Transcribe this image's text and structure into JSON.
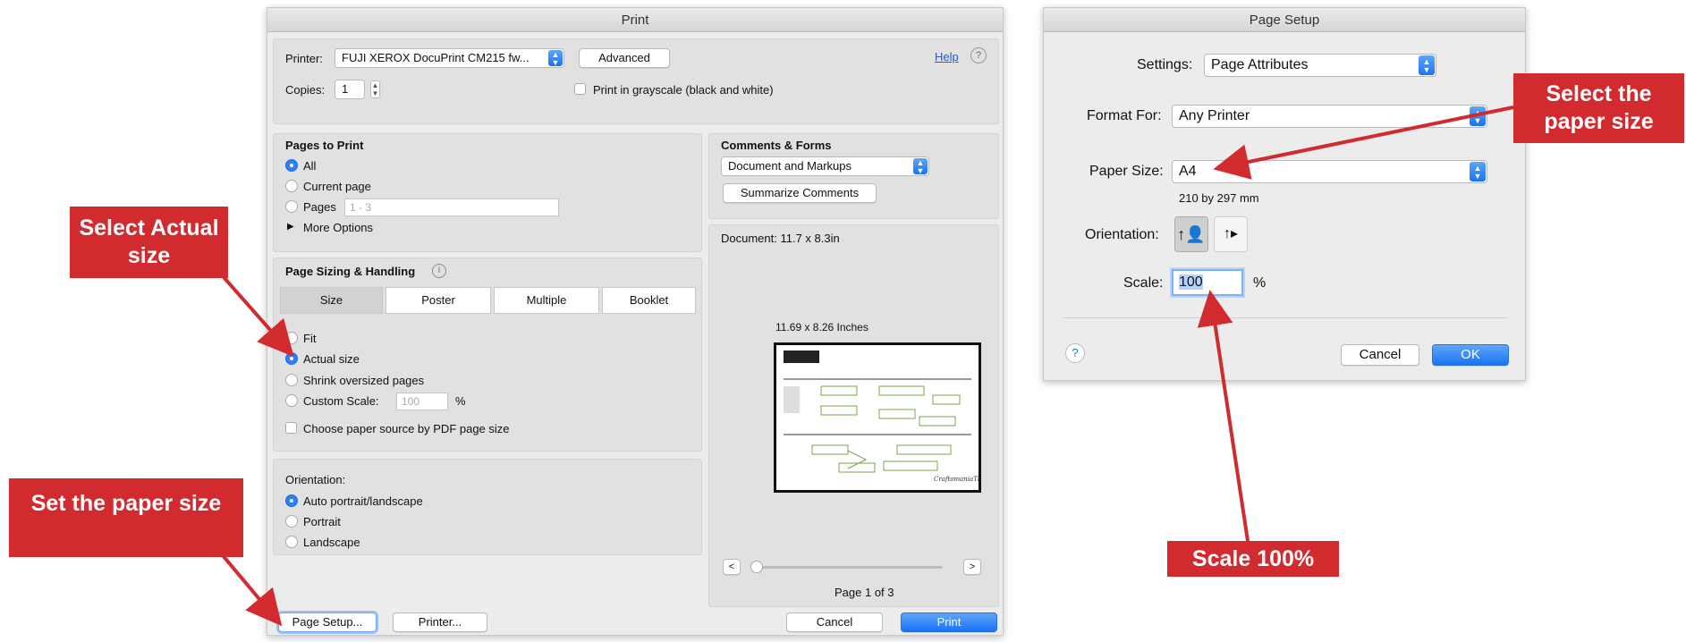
{
  "print": {
    "title": "Print",
    "printer_label": "Printer:",
    "printer_value": "FUJI XEROX DocuPrint CM215 fw...",
    "advanced_label": "Advanced",
    "help_label": "Help",
    "copies_label": "Copies:",
    "copies_value": "1",
    "grayscale_label": "Print in grayscale (black and white)",
    "pages": {
      "heading": "Pages to Print",
      "all": "All",
      "current": "Current page",
      "pages": "Pages",
      "pages_placeholder": "1 - 3",
      "more": "More Options"
    },
    "sizing": {
      "heading": "Page Sizing & Handling",
      "tabs": [
        "Size",
        "Poster",
        "Multiple",
        "Booklet"
      ],
      "fit": "Fit",
      "actual": "Actual size",
      "shrink": "Shrink oversized pages",
      "custom": "Custom Scale:",
      "custom_value": "100",
      "percent": "%",
      "paper_source": "Choose paper source by PDF page size"
    },
    "orientation": {
      "heading": "Orientation:",
      "auto": "Auto portrait/landscape",
      "portrait": "Portrait",
      "landscape": "Landscape"
    },
    "comments": {
      "heading": "Comments & Forms",
      "select": "Document and Markups",
      "summarize": "Summarize Comments"
    },
    "preview": {
      "document": "Document: 11.7 x 8.3in",
      "dimensions": "11.69 x 8.26 Inches",
      "prev": "<",
      "next": ">",
      "page_status": "Page 1 of 3",
      "thumb_signature": "CraftomaniaTime"
    },
    "page_setup_button": "Page Setup...",
    "printer_button": "Printer...",
    "cancel": "Cancel",
    "print": "Print"
  },
  "setup": {
    "title": "Page Setup",
    "settings_label": "Settings:",
    "settings_value": "Page Attributes",
    "format_label": "Format For:",
    "format_value": "Any Printer",
    "paper_label": "Paper Size:",
    "paper_value": "A4",
    "paper_dims": "210 by 297 mm",
    "orientation_label": "Orientation:",
    "scale_label": "Scale:",
    "scale_value": "100",
    "percent": "%",
    "help": "?",
    "cancel": "Cancel",
    "ok": "OK"
  },
  "callouts": {
    "actual_size": "Select Actual size",
    "paper_size_left": "Set the paper size",
    "paper_size_right": "Select the paper size",
    "scale": "Scale 100%"
  },
  "colors": {
    "callout": "#d12a2f",
    "accent": "#2d7ff9"
  }
}
